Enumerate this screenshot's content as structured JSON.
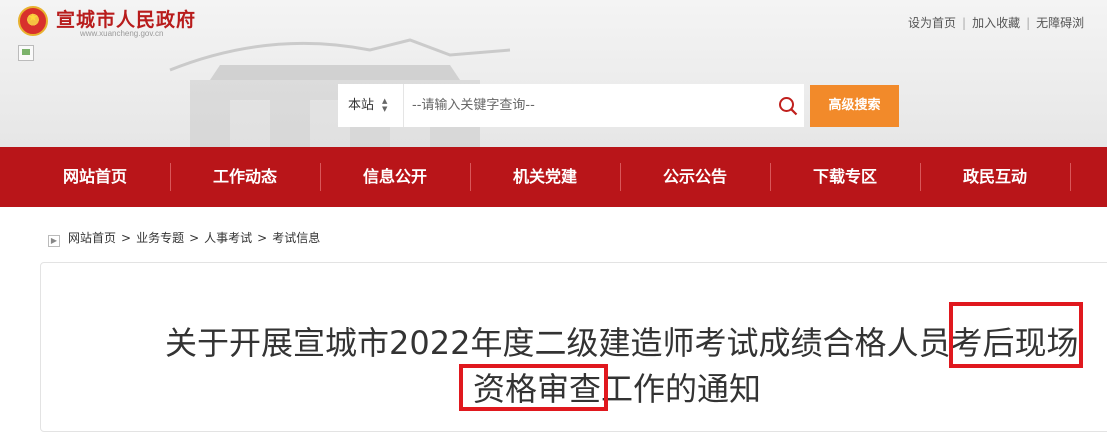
{
  "header": {
    "site_title": "宣城市人民政府",
    "site_url": "www.xuancheng.gov.cn",
    "top_links": [
      "设为首页",
      "加入收藏",
      "无障碍浏"
    ]
  },
  "search": {
    "scope": "本站",
    "placeholder": "--请输入关键字查询--",
    "advanced_label": "高级搜索"
  },
  "nav": {
    "items": [
      "网站首页",
      "工作动态",
      "信息公开",
      "机关党建",
      "公示公告",
      "下载专区",
      "政民互动"
    ]
  },
  "breadcrumb": [
    "网站首页",
    "业务专题",
    "人事考试",
    "考试信息"
  ],
  "article": {
    "title_line1": "关于开展宣城市2022年度二级建造师考试成绩合格人员考后现场",
    "title_line2": "资格审查工作的通知"
  },
  "colors": {
    "nav_red": "#b91519",
    "accent_orange": "#f28a2a",
    "highlight_red": "#e0181e"
  }
}
